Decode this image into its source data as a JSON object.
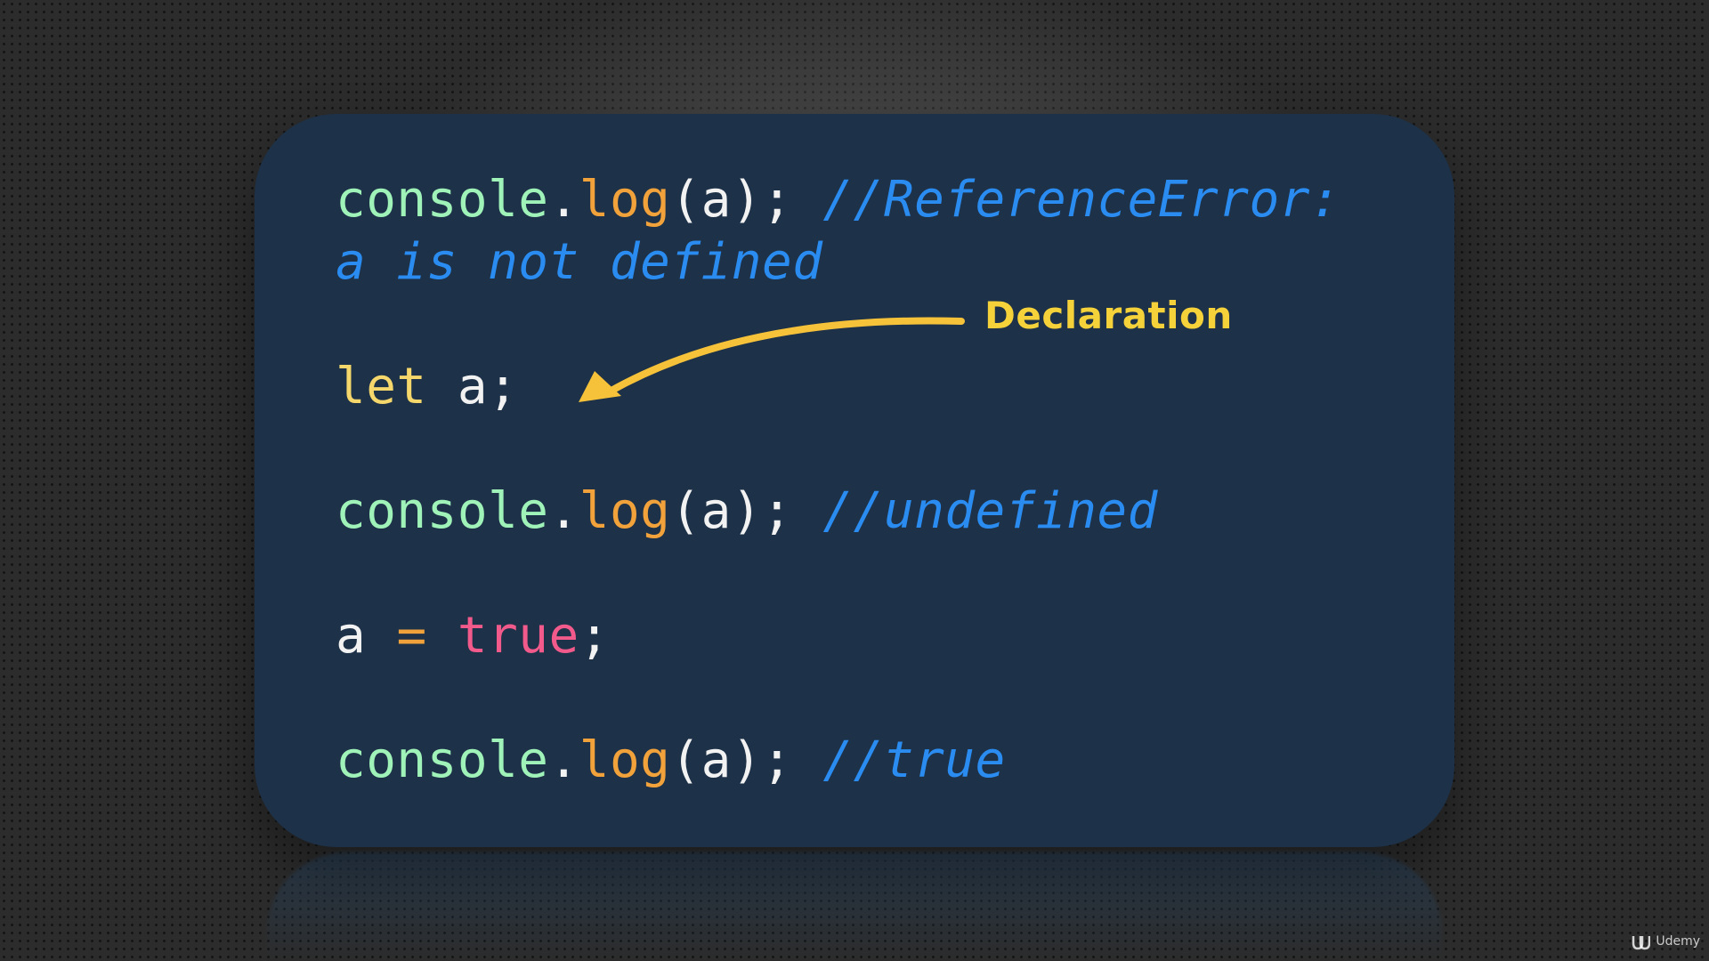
{
  "code": {
    "line1": {
      "obj": "console",
      "dot": ".",
      "fn": "log",
      "args": "(a);",
      "comment": "//ReferenceError:"
    },
    "line2": {
      "comment": "a is not defined"
    },
    "line3": {
      "keyword": "let",
      "rest": "a;"
    },
    "line4": {
      "obj": "console",
      "dot": ".",
      "fn": "log",
      "args": "(a);",
      "comment": "//undefined"
    },
    "line5": {
      "var": "a",
      "op": "=",
      "value": "true",
      "end": ";"
    },
    "line6": {
      "obj": "console",
      "dot": ".",
      "fn": "log",
      "args": "(a);",
      "comment": "//true"
    }
  },
  "annotation": {
    "label": "Declaration"
  },
  "logo": {
    "text": "Udemy"
  },
  "colors": {
    "card": "#1d3148",
    "identifier": "#9ff2b8",
    "function": "#f2a23b",
    "keyword": "#f5d76b",
    "boolean": "#f25a8b",
    "comment": "#2a8cf0",
    "annotation": "#f6d23a"
  }
}
